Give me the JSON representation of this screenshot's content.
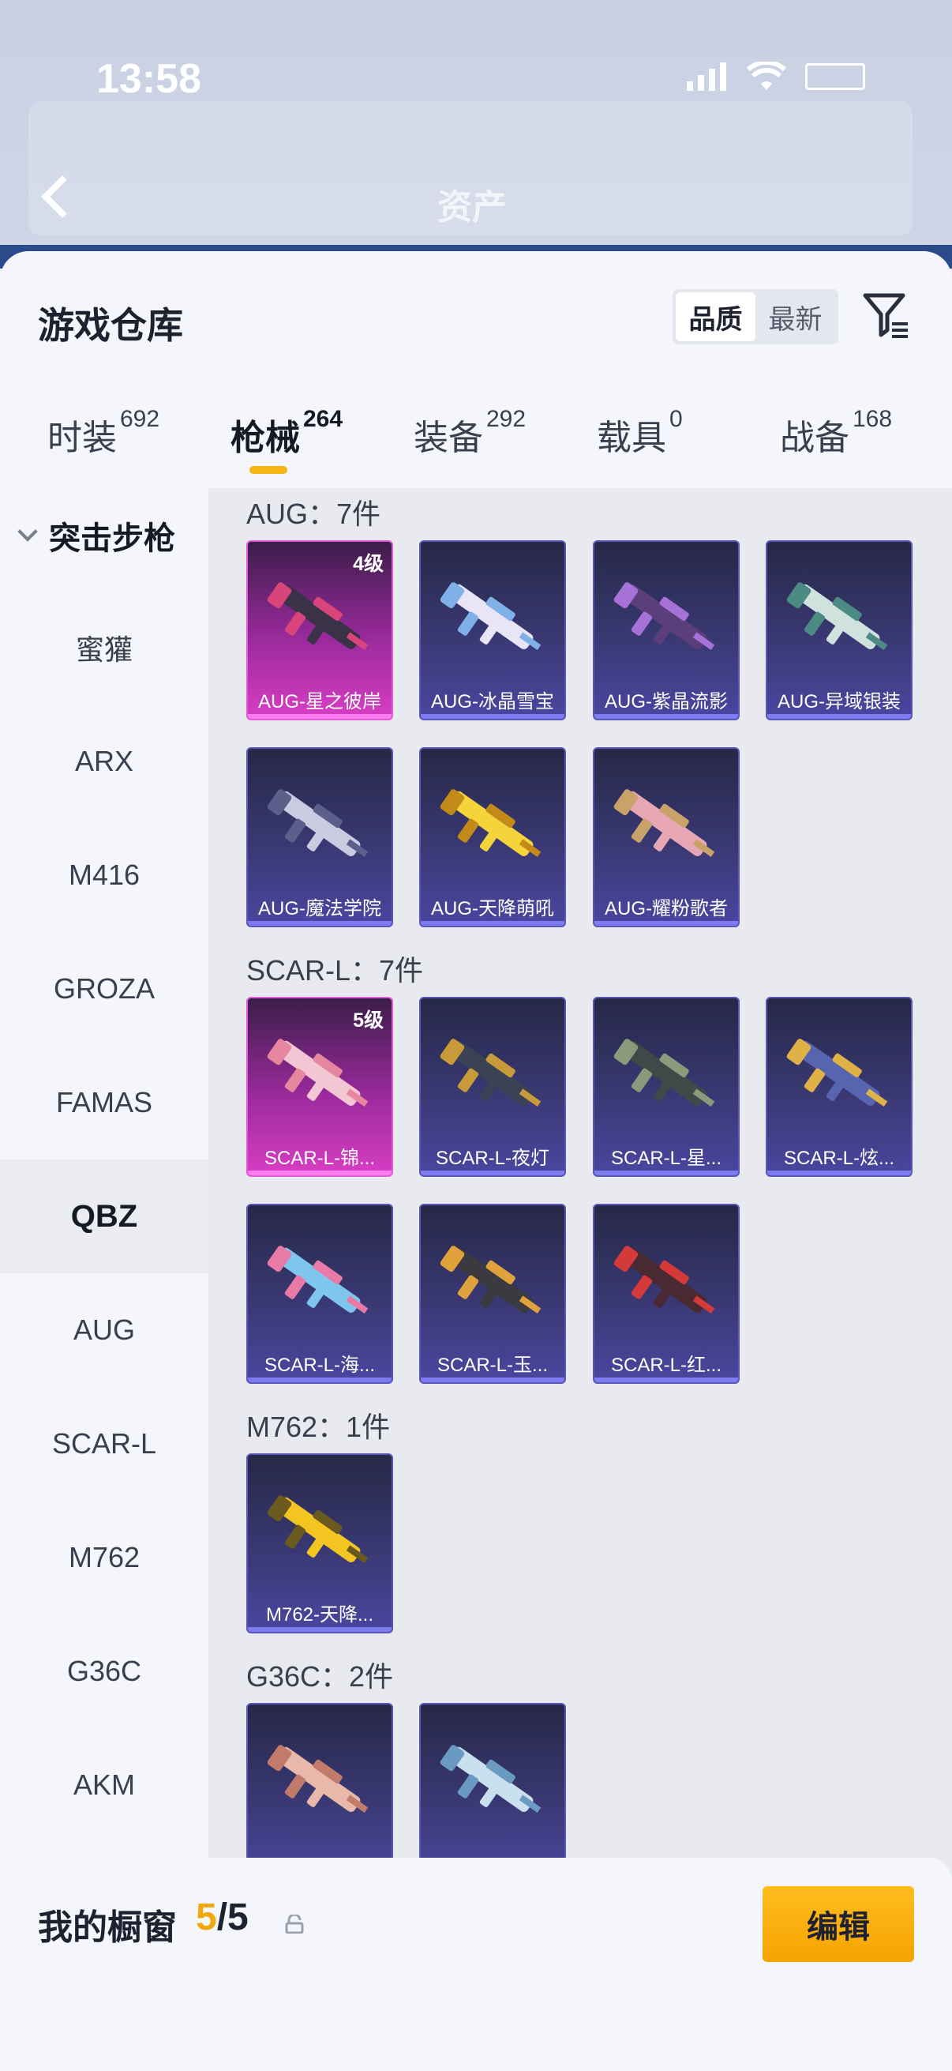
{
  "status_bar": {
    "time": "13:58"
  },
  "header": {
    "title": "资产"
  },
  "sheet": {
    "title": "游戏仓库",
    "sort_options": [
      "品质",
      "最新"
    ],
    "active_sort": "品质"
  },
  "tabs": [
    {
      "label": "时装",
      "count": "692"
    },
    {
      "label": "枪械",
      "count": "264"
    },
    {
      "label": "装备",
      "count": "292"
    },
    {
      "label": "载具",
      "count": "0"
    },
    {
      "label": "战备",
      "count": "168"
    }
  ],
  "sidebar": {
    "category": "突击步枪",
    "items": [
      "蜜獾",
      "ARX",
      "M416",
      "GROZA",
      "FAMAS",
      "QBZ",
      "AUG",
      "SCAR-L",
      "M762",
      "G36C",
      "AKM"
    ],
    "selected": "QBZ"
  },
  "groups": [
    {
      "label": "AUG：7件",
      "items": [
        {
          "name": "AUG-星之彼岸",
          "level": "4级",
          "rarity": "purple"
        },
        {
          "name": "AUG-冰晶雪宝",
          "level": "",
          "rarity": "blue"
        },
        {
          "name": "AUG-紫晶流影",
          "level": "",
          "rarity": "blue"
        },
        {
          "name": "AUG-异域银装",
          "level": "",
          "rarity": "blue"
        },
        {
          "name": "AUG-魔法学院",
          "level": "",
          "rarity": "blue"
        },
        {
          "name": "AUG-天降萌吼",
          "level": "",
          "rarity": "blue"
        },
        {
          "name": "AUG-耀粉歌者",
          "level": "",
          "rarity": "blue"
        }
      ]
    },
    {
      "label": "SCAR-L：7件",
      "items": [
        {
          "name": "SCAR-L-锦...",
          "level": "5级",
          "rarity": "purple"
        },
        {
          "name": "SCAR-L-夜灯",
          "level": "",
          "rarity": "blue"
        },
        {
          "name": "SCAR-L-星...",
          "level": "",
          "rarity": "blue"
        },
        {
          "name": "SCAR-L-炫...",
          "level": "",
          "rarity": "blue"
        },
        {
          "name": "SCAR-L-海...",
          "level": "",
          "rarity": "blue"
        },
        {
          "name": "SCAR-L-玉...",
          "level": "",
          "rarity": "blue"
        },
        {
          "name": "SCAR-L-红...",
          "level": "",
          "rarity": "blue"
        }
      ]
    },
    {
      "label": "M762：1件",
      "items": [
        {
          "name": "M762-天降...",
          "level": "",
          "rarity": "blue"
        }
      ]
    },
    {
      "label": "G36C：2件",
      "items": [
        {
          "name": "",
          "level": "",
          "rarity": "blue"
        },
        {
          "name": "",
          "level": "",
          "rarity": "blue"
        }
      ]
    }
  ],
  "showcase": {
    "title": "我的橱窗",
    "current": "5",
    "separator": "/",
    "total": "5",
    "edit_label": "编辑"
  },
  "colors": {
    "accent": "#f5b515",
    "purple_rarity": "#d83ec4",
    "blue_rarity": "#4a46a0"
  }
}
